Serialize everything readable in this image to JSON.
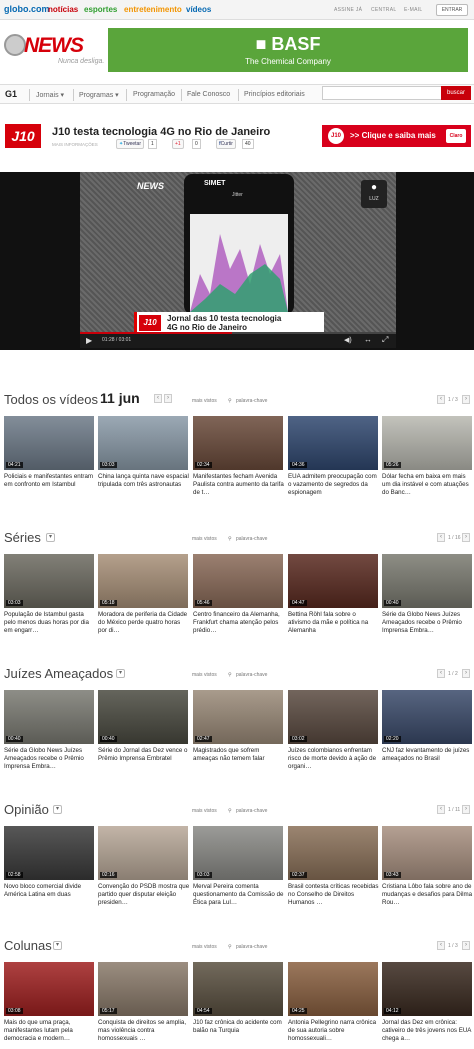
{
  "topbar": {
    "logo": "globo.com",
    "nav": [
      "notícias",
      "esportes",
      "entretenimento",
      "vídeos"
    ],
    "nav_colors": [
      "#c8000a",
      "#2f9e2f",
      "#f29400",
      "#0669b2"
    ],
    "util": [
      "ASSINE JÁ",
      "CENTRAL",
      "E-MAIL"
    ],
    "login_label": "ENTRAR"
  },
  "header": {
    "brand": "NEWS",
    "slogan": "Nunca desliga.",
    "ad": {
      "brand": "■ BASF",
      "tagline": "The Chemical Company"
    }
  },
  "menu": {
    "logo": "G1",
    "items": [
      "Jornais",
      "Programas",
      "Programação",
      "Fale Conosco",
      "Princípios editoriais"
    ],
    "search_button": "buscar"
  },
  "program": {
    "logo": "J10",
    "title": "J10 testa tecnologia 4G no Rio de Janeiro",
    "more_label": "MAIS INFORMAÇÕES",
    "tweet_label": "Tweetar",
    "tweet_count": "1",
    "plus_label": "+1",
    "plus_count": "0",
    "like_label": "Curtir",
    "like_count": "40",
    "ad_text": ">> Clique e saiba mais",
    "ad_brand": "Claro"
  },
  "player": {
    "overlay_logo": "NEWS",
    "phone_text": "SIMET",
    "phone_sub": "Jitter",
    "lower_third_logo": "J10",
    "lower_third_line1": "Jornal das 10 testa tecnologia",
    "lower_third_line2": "4G no Rio de Janeiro",
    "light_label": "LUZ",
    "time": "01:28 / 03:01",
    "progress": 0.48
  },
  "sections": [
    {
      "title": "Todos os vídeos",
      "date": "11 jun",
      "sort": "mais vistos",
      "search_placeholder": "palavra-chave",
      "page": "1 / 3",
      "items": [
        {
          "duration": "04:21",
          "caption": "Policiais e manifestantes entram em confronto em Istambul",
          "color": "#6d7a88"
        },
        {
          "duration": "03:03",
          "caption": "China lança quinta nave espacial tripulada com três astronautas",
          "color": "#8a9aa8"
        },
        {
          "duration": "02:34",
          "caption": "Manifestantes fecham Avenida Paulista contra aumento da tarifa de t…",
          "color": "#6a4a3a"
        },
        {
          "duration": "04:36",
          "caption": "EUA admitem preocupação com o vazamento de segredos da espionagem",
          "color": "#304870"
        },
        {
          "duration": "05:26",
          "caption": "Dólar fecha em baixa em mais um dia instável e com atuações do Banc…",
          "color": "#b8b8b0"
        }
      ]
    },
    {
      "title": "Séries",
      "sort": "mais vistos",
      "search_placeholder": "palavra-chave",
      "page": "1 / 16",
      "items": [
        {
          "duration": "03:03",
          "caption": "População de Istambul gasta pelo menos duas horas por dia em engarr…",
          "color": "#6c6a60"
        },
        {
          "duration": "05:18",
          "caption": "Moradora de periferia da Cidade do México perde quatro horas por di…",
          "color": "#a89078"
        },
        {
          "duration": "05:46",
          "caption": "Centro financeiro da Alemanha, Frankfurt chama atenção pelos prédio…",
          "color": "#8a6a58"
        },
        {
          "duration": "04:47",
          "caption": "Bettina Röhl fala sobre o ativismo da mãe e política na Alemanha",
          "color": "#5a2a20"
        },
        {
          "duration": "00:40",
          "caption": "Série da Globo News Juízes Ameaçados recebe o Prêmio Imprensa Embra…",
          "color": "#7a7a70"
        }
      ]
    },
    {
      "title": "Juízes Ameaçados",
      "sort": "mais vistos",
      "search_placeholder": "palavra-chave",
      "page": "1 / 2",
      "items": [
        {
          "duration": "00:40",
          "caption": "Série da Globo News Juízes Ameaçados recebe o Prêmio Imprensa Embra…",
          "color": "#7a7a72"
        },
        {
          "duration": "00:40",
          "caption": "Série do Jornal das Dez vence o Prêmio Imprensa Embratel",
          "color": "#4a4a40"
        },
        {
          "duration": "02:47",
          "caption": "Magistrados que sofrem ameaças não temem falar",
          "color": "#9a8a78"
        },
        {
          "duration": "03:02",
          "caption": "Juízes colombianos enfrentam risco de morte devido à ação de organi…",
          "color": "#5a4a40"
        },
        {
          "duration": "02:20",
          "caption": "CNJ faz levantamento de juízes ameaçados no Brasil",
          "color": "#3a4a6a"
        }
      ]
    },
    {
      "title": "Opinião",
      "sort": "mais vistos",
      "search_placeholder": "palavra-chave",
      "page": "1 / 11",
      "items": [
        {
          "duration": "02:58",
          "caption": "Novo bloco comercial divide América Latina em duas",
          "color": "#3a3a3a"
        },
        {
          "duration": "02:16",
          "caption": "Convenção do PSDB mostra que partido quer disputar eleição presiden…",
          "color": "#b8a898"
        },
        {
          "duration": "03:03",
          "caption": "Merval Pereira comenta questionamento da Comissão de Ética para Lul…",
          "color": "#8a8a86"
        },
        {
          "duration": "02:37",
          "caption": "Brasil contesta críticas recebidas no Conselho de Direitos Humanos …",
          "color": "#8a7058"
        },
        {
          "duration": "03:43",
          "caption": "Cristiana Lôbo fala sobre ano de mudanças e desafios para Dilma Rou…",
          "color": "#a89080"
        }
      ]
    },
    {
      "title": "Colunas",
      "sort": "mais vistos",
      "search_placeholder": "palavra-chave",
      "page": "1 / 3",
      "items": [
        {
          "duration": "03:08",
          "caption": "Mais do que uma praça, manifestantes lutam pela democracia e modern…",
          "color": "#a02020"
        },
        {
          "duration": "05:17",
          "caption": "Conquista de direitos se amplia, mas violência contra homossexuais …",
          "color": "#8a7a6a"
        },
        {
          "duration": "04:54",
          "caption": "J10 faz crônica do acidente com balão na Turquia",
          "color": "#5a5040"
        },
        {
          "duration": "04:25",
          "caption": "Antonia Pellegrino narra crônica de sua autoria sobre homossexuali…",
          "color": "#8a6040"
        },
        {
          "duration": "04:12",
          "caption": "Jornal das Dez em crônica: cativeiro de três jovens nos EUA chega a…",
          "color": "#3a2a20"
        }
      ]
    }
  ]
}
